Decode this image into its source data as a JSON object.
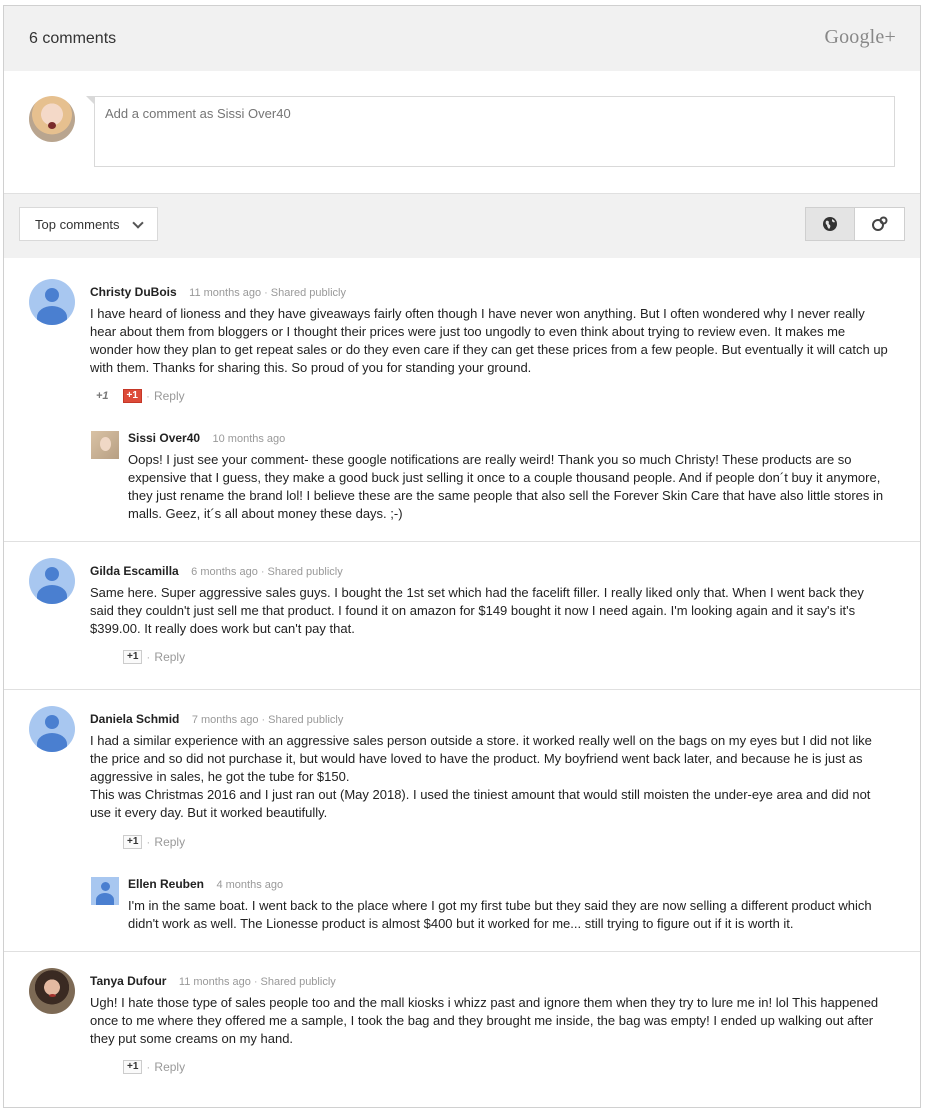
{
  "header": {
    "count_label": "6 comments",
    "brand": "Google+"
  },
  "compose": {
    "placeholder": "Add a comment as Sissi Over40"
  },
  "toolbar": {
    "sort_label": "Top comments"
  },
  "comments": [
    {
      "author": "Christy DuBois",
      "time": "11 months ago",
      "visibility": "Shared publicly",
      "text": "I have heard of lioness and they have giveaways fairly often though I have never won anything. But I often wondered why I never really hear about them from bloggers or I thought their prices were just too ungodly to even think about trying to review even. It makes me wonder how they plan to get repeat sales or do they even care if they can get these prices from a few people. But eventually it will catch up with them. Thanks for sharing this. So proud of you for standing your ground.",
      "plus_count": "+1",
      "plus_label": "+1",
      "reply_label": "Reply",
      "reply": {
        "author": "Sissi Over40",
        "time": "10 months ago",
        "text": "Oops! I just see your comment- these google notifications are really weird! Thank you so much Christy! These products are so expensive that I guess, they make a good buck just selling it once to a couple thousand people. And if people don´t buy it anymore, they just rename the brand lol! I believe these are the same people that also sell the Forever Skin Care that have also little stores in malls. Geez, it´s all about money these days. ;-)"
      }
    },
    {
      "author": "Gilda Escamilla",
      "time": "6 months ago",
      "visibility": "Shared publicly",
      "text": "Same here. Super aggressive sales guys. I bought the 1st set which had the facelift filler. I really liked only that. When I went back they said they couldn't just sell me that product. I found it on amazon for $149 bought it now I need again. I'm looking again and it say's it's $399.00. It really does work but can't pay that.",
      "plus_label": "+1",
      "reply_label": "Reply"
    },
    {
      "author": "Daniela Schmid",
      "time": "7 months ago",
      "visibility": "Shared publicly",
      "text": "I had a similar experience with an aggressive sales person outside a store. it worked really well on the bags on my eyes but I did not like the price and so did not purchase it, but would have loved to have the product. My boyfriend went back later, and because he is just as aggressive in sales, he got the tube for $150.",
      "text2": "This was Christmas 2016 and I just ran out (May 2018). I used the tiniest amount that would still moisten the under-eye area and did not use it every day. But it worked beautifully.",
      "plus_label": "+1",
      "reply_label": "Reply",
      "reply": {
        "author": "Ellen Reuben",
        "time": "4 months ago",
        "text": "I'm in the same boat. I went back to the place where I got my first tube but they said they are now selling a different product which didn't work as well. The Lionesse product is almost $400 but it worked for me... still trying to figure out if it is worth it."
      }
    },
    {
      "author": "Tanya Dufour",
      "time": "11 months ago",
      "visibility": "Shared publicly",
      "text": "Ugh! I hate those type of sales people too and the mall kiosks i whizz past and ignore them when they try to lure me in! lol This happened once to me where they offered me a sample, I took the bag and they brought me inside, the bag was empty! I ended up walking out after they put some creams on my hand.",
      "plus_label": "+1",
      "reply_label": "Reply"
    }
  ],
  "separator": "·",
  "colors": {
    "header_bg": "#f1f1f1",
    "avatar_blue": "#4a7fd0",
    "plus_red": "#dd4b39"
  },
  "icons": [
    "globe-icon",
    "circles-icon",
    "chevron-down-icon",
    "person-avatar-icon"
  ]
}
